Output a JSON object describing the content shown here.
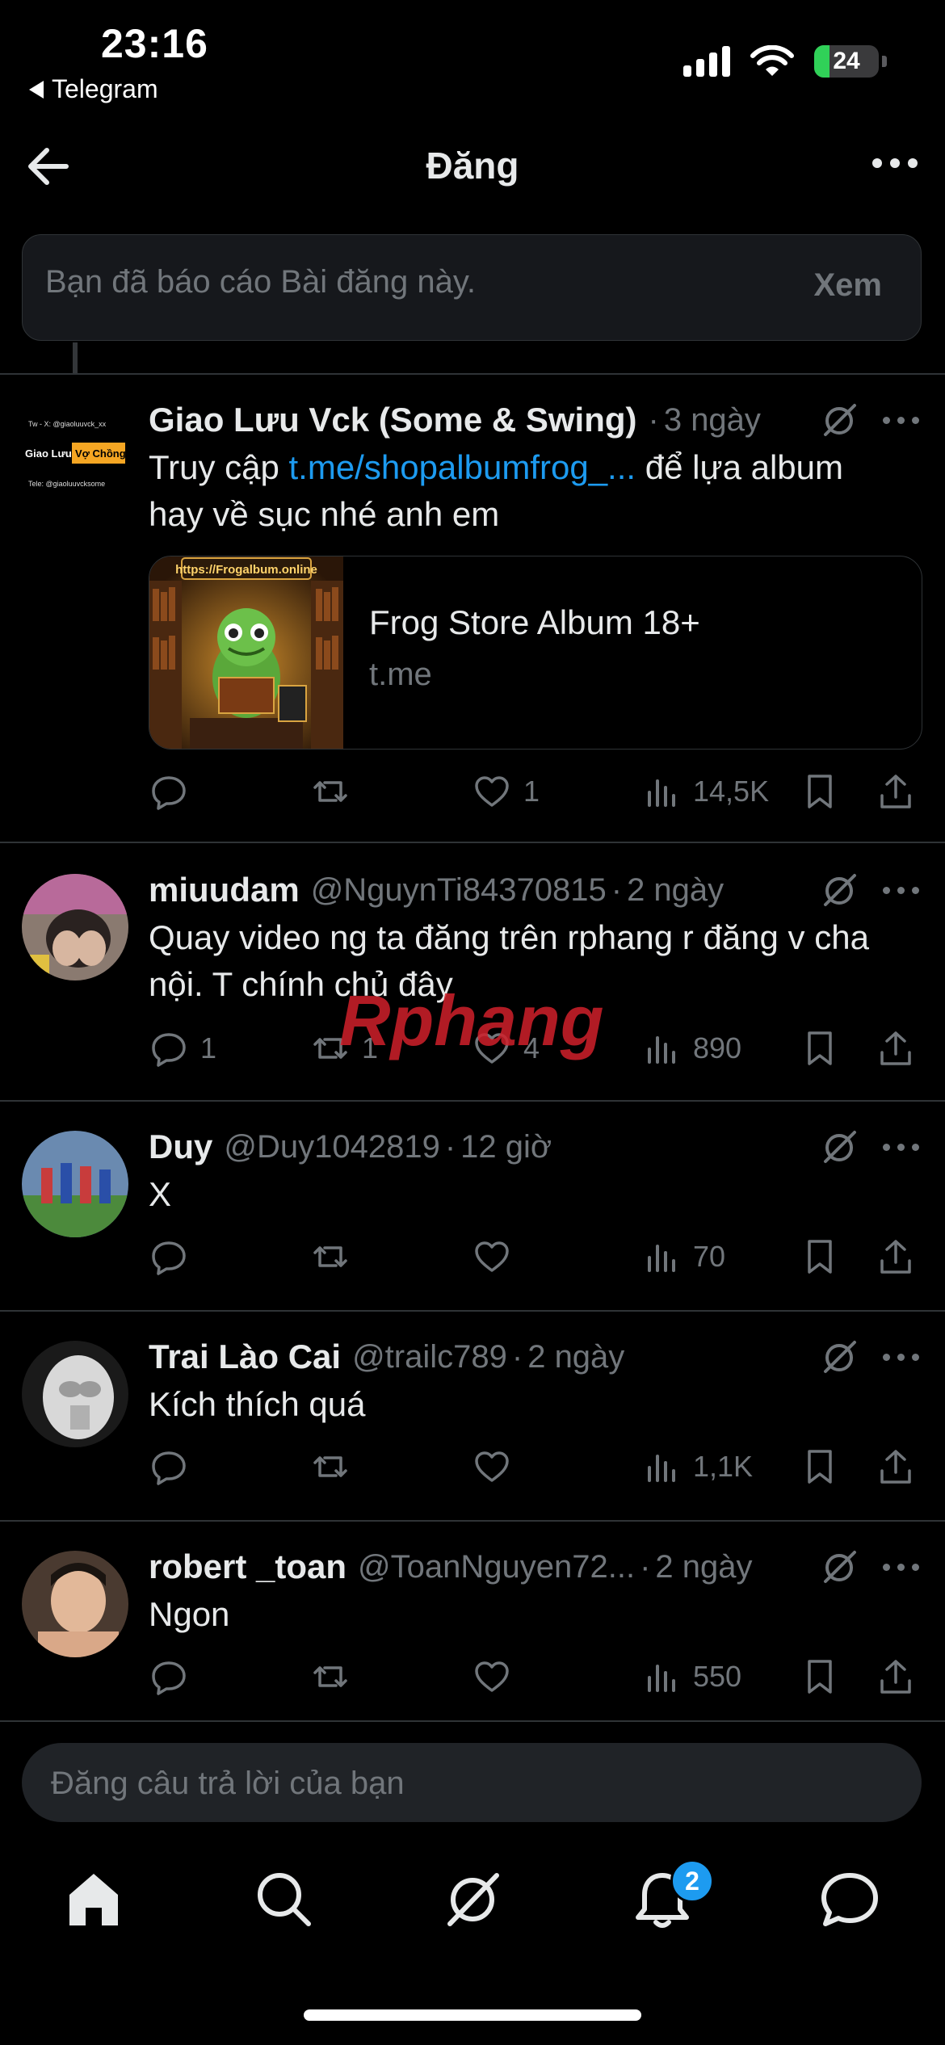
{
  "status_bar": {
    "time": "23:16",
    "back_app": "Telegram",
    "battery_level": "24",
    "battery_fraction": 0.24,
    "icons": [
      "signal-icon",
      "wifi-icon",
      "battery-charging-icon"
    ]
  },
  "header": {
    "title": "Đăng",
    "back_icon": "arrow-left-icon",
    "more_icon": "more-icon"
  },
  "reported_banner": {
    "text": "Bạn đã báo cáo Bài đăng này.",
    "action": "Xem"
  },
  "posts": [
    {
      "name": "Giao Lưu Vck (Some & Swing)",
      "handle": "",
      "time": "3 ngày",
      "text_before": "Truy cập ",
      "link": "t.me/shopalbumfrog_...",
      "text_after": " để lựa album hay về sục nhé anh em",
      "card": {
        "title": "Frog Store Album 18+",
        "domain": "t.me",
        "image_text": "https://Frogalbum.online"
      },
      "avatar_text": {
        "line1": "Tw - X: @giaoluuvck_xx",
        "line2": "Giao Lưu",
        "line3": "Vợ Chồng",
        "line4": "Tele: @giaoluuvcksome"
      },
      "replies": "",
      "reposts": "",
      "likes": "1",
      "views": "14,5K"
    },
    {
      "name": "miuudam",
      "handle": "@NguynTi84370815",
      "time": "2 ngày",
      "text": "Quay video ng ta đăng trên rphang r đăng v cha nội. T chính chủ đây",
      "replies": "1",
      "reposts": "1",
      "likes": "4",
      "views": "890"
    },
    {
      "name": "Duy",
      "handle": "@Duy1042819",
      "time": "12 giờ",
      "text": "X",
      "replies": "",
      "reposts": "",
      "likes": "",
      "views": "70"
    },
    {
      "name": "Trai Lào Cai",
      "handle": "@trailc789",
      "time": "2 ngày",
      "text": "Kích thích quá",
      "replies": "",
      "reposts": "",
      "likes": "",
      "views": "1,1K"
    },
    {
      "name": "robert _toan",
      "handle": "@ToanNguyen72...",
      "time": "2 ngày",
      "text": "Ngon",
      "replies": "",
      "reposts": "",
      "likes": "",
      "views": "550"
    }
  ],
  "post_meta": {
    "separator": "·"
  },
  "watermark": "Rphang",
  "reply_bar": {
    "placeholder": "Đăng câu trả lời của bạn"
  },
  "tabbar": {
    "tabs": [
      "home-icon",
      "search-icon",
      "grok-icon",
      "notifications-icon",
      "messages-icon"
    ],
    "notification_badge": "2"
  },
  "colors": {
    "background": "#000000",
    "text": "#e7e9ea",
    "muted": "#71767b",
    "accent": "#1d9bf0",
    "border": "#2f3336",
    "battery": "#30d158"
  }
}
